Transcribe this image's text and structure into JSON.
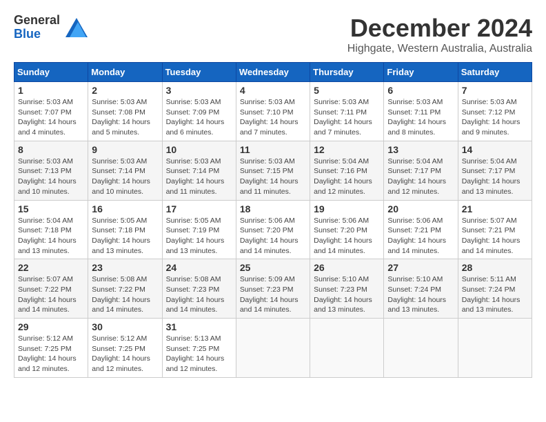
{
  "header": {
    "logo_line1": "General",
    "logo_line2": "Blue",
    "month_title": "December 2024",
    "location": "Highgate, Western Australia, Australia"
  },
  "weekdays": [
    "Sunday",
    "Monday",
    "Tuesday",
    "Wednesday",
    "Thursday",
    "Friday",
    "Saturday"
  ],
  "weeks": [
    [
      {
        "day": "1",
        "sunrise": "Sunrise: 5:03 AM",
        "sunset": "Sunset: 7:07 PM",
        "daylight": "Daylight: 14 hours and 4 minutes."
      },
      {
        "day": "2",
        "sunrise": "Sunrise: 5:03 AM",
        "sunset": "Sunset: 7:08 PM",
        "daylight": "Daylight: 14 hours and 5 minutes."
      },
      {
        "day": "3",
        "sunrise": "Sunrise: 5:03 AM",
        "sunset": "Sunset: 7:09 PM",
        "daylight": "Daylight: 14 hours and 6 minutes."
      },
      {
        "day": "4",
        "sunrise": "Sunrise: 5:03 AM",
        "sunset": "Sunset: 7:10 PM",
        "daylight": "Daylight: 14 hours and 7 minutes."
      },
      {
        "day": "5",
        "sunrise": "Sunrise: 5:03 AM",
        "sunset": "Sunset: 7:11 PM",
        "daylight": "Daylight: 14 hours and 7 minutes."
      },
      {
        "day": "6",
        "sunrise": "Sunrise: 5:03 AM",
        "sunset": "Sunset: 7:11 PM",
        "daylight": "Daylight: 14 hours and 8 minutes."
      },
      {
        "day": "7",
        "sunrise": "Sunrise: 5:03 AM",
        "sunset": "Sunset: 7:12 PM",
        "daylight": "Daylight: 14 hours and 9 minutes."
      }
    ],
    [
      {
        "day": "8",
        "sunrise": "Sunrise: 5:03 AM",
        "sunset": "Sunset: 7:13 PM",
        "daylight": "Daylight: 14 hours and 10 minutes."
      },
      {
        "day": "9",
        "sunrise": "Sunrise: 5:03 AM",
        "sunset": "Sunset: 7:14 PM",
        "daylight": "Daylight: 14 hours and 10 minutes."
      },
      {
        "day": "10",
        "sunrise": "Sunrise: 5:03 AM",
        "sunset": "Sunset: 7:14 PM",
        "daylight": "Daylight: 14 hours and 11 minutes."
      },
      {
        "day": "11",
        "sunrise": "Sunrise: 5:03 AM",
        "sunset": "Sunset: 7:15 PM",
        "daylight": "Daylight: 14 hours and 11 minutes."
      },
      {
        "day": "12",
        "sunrise": "Sunrise: 5:04 AM",
        "sunset": "Sunset: 7:16 PM",
        "daylight": "Daylight: 14 hours and 12 minutes."
      },
      {
        "day": "13",
        "sunrise": "Sunrise: 5:04 AM",
        "sunset": "Sunset: 7:17 PM",
        "daylight": "Daylight: 14 hours and 12 minutes."
      },
      {
        "day": "14",
        "sunrise": "Sunrise: 5:04 AM",
        "sunset": "Sunset: 7:17 PM",
        "daylight": "Daylight: 14 hours and 13 minutes."
      }
    ],
    [
      {
        "day": "15",
        "sunrise": "Sunrise: 5:04 AM",
        "sunset": "Sunset: 7:18 PM",
        "daylight": "Daylight: 14 hours and 13 minutes."
      },
      {
        "day": "16",
        "sunrise": "Sunrise: 5:05 AM",
        "sunset": "Sunset: 7:18 PM",
        "daylight": "Daylight: 14 hours and 13 minutes."
      },
      {
        "day": "17",
        "sunrise": "Sunrise: 5:05 AM",
        "sunset": "Sunset: 7:19 PM",
        "daylight": "Daylight: 14 hours and 13 minutes."
      },
      {
        "day": "18",
        "sunrise": "Sunrise: 5:06 AM",
        "sunset": "Sunset: 7:20 PM",
        "daylight": "Daylight: 14 hours and 14 minutes."
      },
      {
        "day": "19",
        "sunrise": "Sunrise: 5:06 AM",
        "sunset": "Sunset: 7:20 PM",
        "daylight": "Daylight: 14 hours and 14 minutes."
      },
      {
        "day": "20",
        "sunrise": "Sunrise: 5:06 AM",
        "sunset": "Sunset: 7:21 PM",
        "daylight": "Daylight: 14 hours and 14 minutes."
      },
      {
        "day": "21",
        "sunrise": "Sunrise: 5:07 AM",
        "sunset": "Sunset: 7:21 PM",
        "daylight": "Daylight: 14 hours and 14 minutes."
      }
    ],
    [
      {
        "day": "22",
        "sunrise": "Sunrise: 5:07 AM",
        "sunset": "Sunset: 7:22 PM",
        "daylight": "Daylight: 14 hours and 14 minutes."
      },
      {
        "day": "23",
        "sunrise": "Sunrise: 5:08 AM",
        "sunset": "Sunset: 7:22 PM",
        "daylight": "Daylight: 14 hours and 14 minutes."
      },
      {
        "day": "24",
        "sunrise": "Sunrise: 5:08 AM",
        "sunset": "Sunset: 7:23 PM",
        "daylight": "Daylight: 14 hours and 14 minutes."
      },
      {
        "day": "25",
        "sunrise": "Sunrise: 5:09 AM",
        "sunset": "Sunset: 7:23 PM",
        "daylight": "Daylight: 14 hours and 14 minutes."
      },
      {
        "day": "26",
        "sunrise": "Sunrise: 5:10 AM",
        "sunset": "Sunset: 7:23 PM",
        "daylight": "Daylight: 14 hours and 13 minutes."
      },
      {
        "day": "27",
        "sunrise": "Sunrise: 5:10 AM",
        "sunset": "Sunset: 7:24 PM",
        "daylight": "Daylight: 14 hours and 13 minutes."
      },
      {
        "day": "28",
        "sunrise": "Sunrise: 5:11 AM",
        "sunset": "Sunset: 7:24 PM",
        "daylight": "Daylight: 14 hours and 13 minutes."
      }
    ],
    [
      {
        "day": "29",
        "sunrise": "Sunrise: 5:12 AM",
        "sunset": "Sunset: 7:25 PM",
        "daylight": "Daylight: 14 hours and 12 minutes."
      },
      {
        "day": "30",
        "sunrise": "Sunrise: 5:12 AM",
        "sunset": "Sunset: 7:25 PM",
        "daylight": "Daylight: 14 hours and 12 minutes."
      },
      {
        "day": "31",
        "sunrise": "Sunrise: 5:13 AM",
        "sunset": "Sunset: 7:25 PM",
        "daylight": "Daylight: 14 hours and 12 minutes."
      },
      null,
      null,
      null,
      null
    ]
  ]
}
